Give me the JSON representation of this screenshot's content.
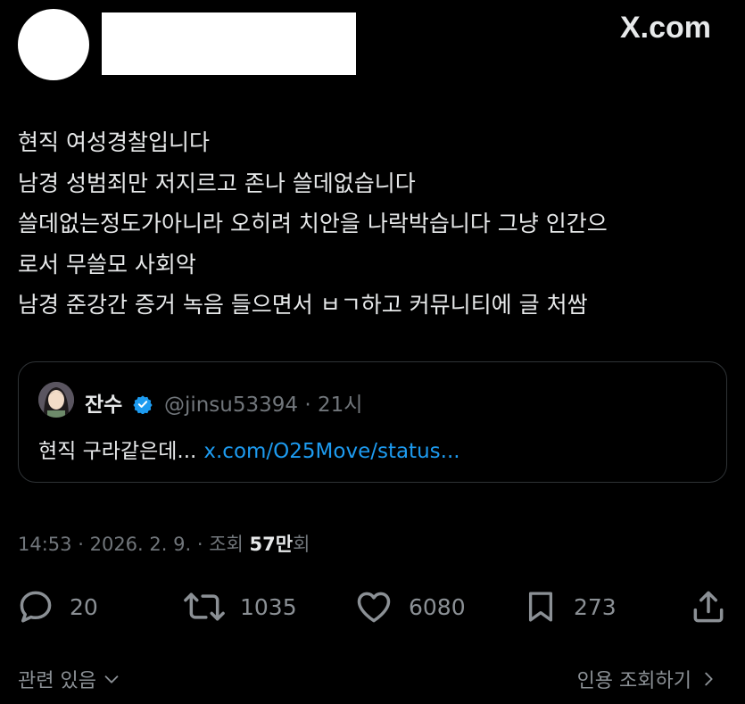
{
  "header": {
    "brand": "X.com"
  },
  "tweet": {
    "lines": [
      "현직 여성경찰입니다",
      "남경 성범죄만 저지르고 존나 쓸데없습니다",
      "쓸데없는정도가아니라 오히려 치안을 나락박습니다 그냥 인간으",
      "로서 무쓸모 사회악",
      "남경 준강간 증거 녹음 들으면서 ㅂㄱ하고 커뮤니티에 글 처쌈"
    ]
  },
  "quote": {
    "name": "잔수",
    "handle": "@jinsu53394",
    "separator": "·",
    "time": "21시",
    "text": "현직 구라같은데...",
    "link": "x.com/O25Move/status..."
  },
  "meta": {
    "time": "14:53",
    "sep1": "·",
    "date": "2026. 2. 9.",
    "sep2": "·",
    "views_label": "조회",
    "views_number": "57만",
    "views_suffix": "회"
  },
  "actions": {
    "replies": "20",
    "reposts": "1035",
    "likes": "6080",
    "bookmarks": "273"
  },
  "footer": {
    "related": "관련 있음",
    "quotes": "인용 조회하기"
  },
  "colors": {
    "background": "#000000",
    "text": "#e7e9ea",
    "muted": "#71767b",
    "link": "#1d9bf0",
    "verified": "#1d9bf0",
    "border": "#2f3336"
  }
}
